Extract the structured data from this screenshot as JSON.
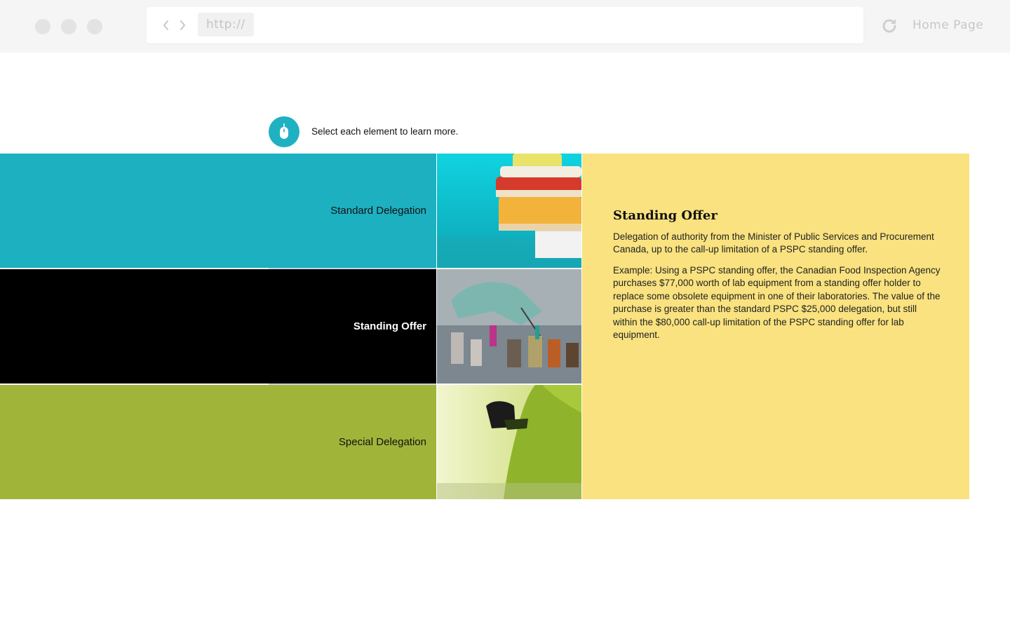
{
  "browser": {
    "url": "http://",
    "home_label": "Home Page"
  },
  "instruction": {
    "text": "Select each element to learn more."
  },
  "options": [
    {
      "label": "Standard Delegation",
      "color": "#1cb0c1"
    },
    {
      "label": "Standing Offer",
      "color": "#000000"
    },
    {
      "label": "Special Delegation",
      "color": "#a1b43a"
    }
  ],
  "panel": {
    "title": "Standing Offer",
    "paragraph1": "Delegation of authority from the Minister of Public Services and Procurement Canada, up to the call-up limitation of a PSPC standing offer.",
    "paragraph2": "Example: Using a PSPC standing offer, the Canadian Food Inspection Agency purchases $77,000 worth of lab equipment from a standing offer holder to replace some obsolete equipment in one of their laboratories. The value of the purchase is greater than the standard PSPC $25,000 delegation, but still within the $80,000 call-up limitation of the PSPC standing offer for lab equipment.",
    "background": "#f9e27f"
  },
  "icons": {
    "instruction": "mouse-icon",
    "back": "chevron-left-icon",
    "forward": "chevron-right-icon",
    "reload": "reload-icon"
  }
}
